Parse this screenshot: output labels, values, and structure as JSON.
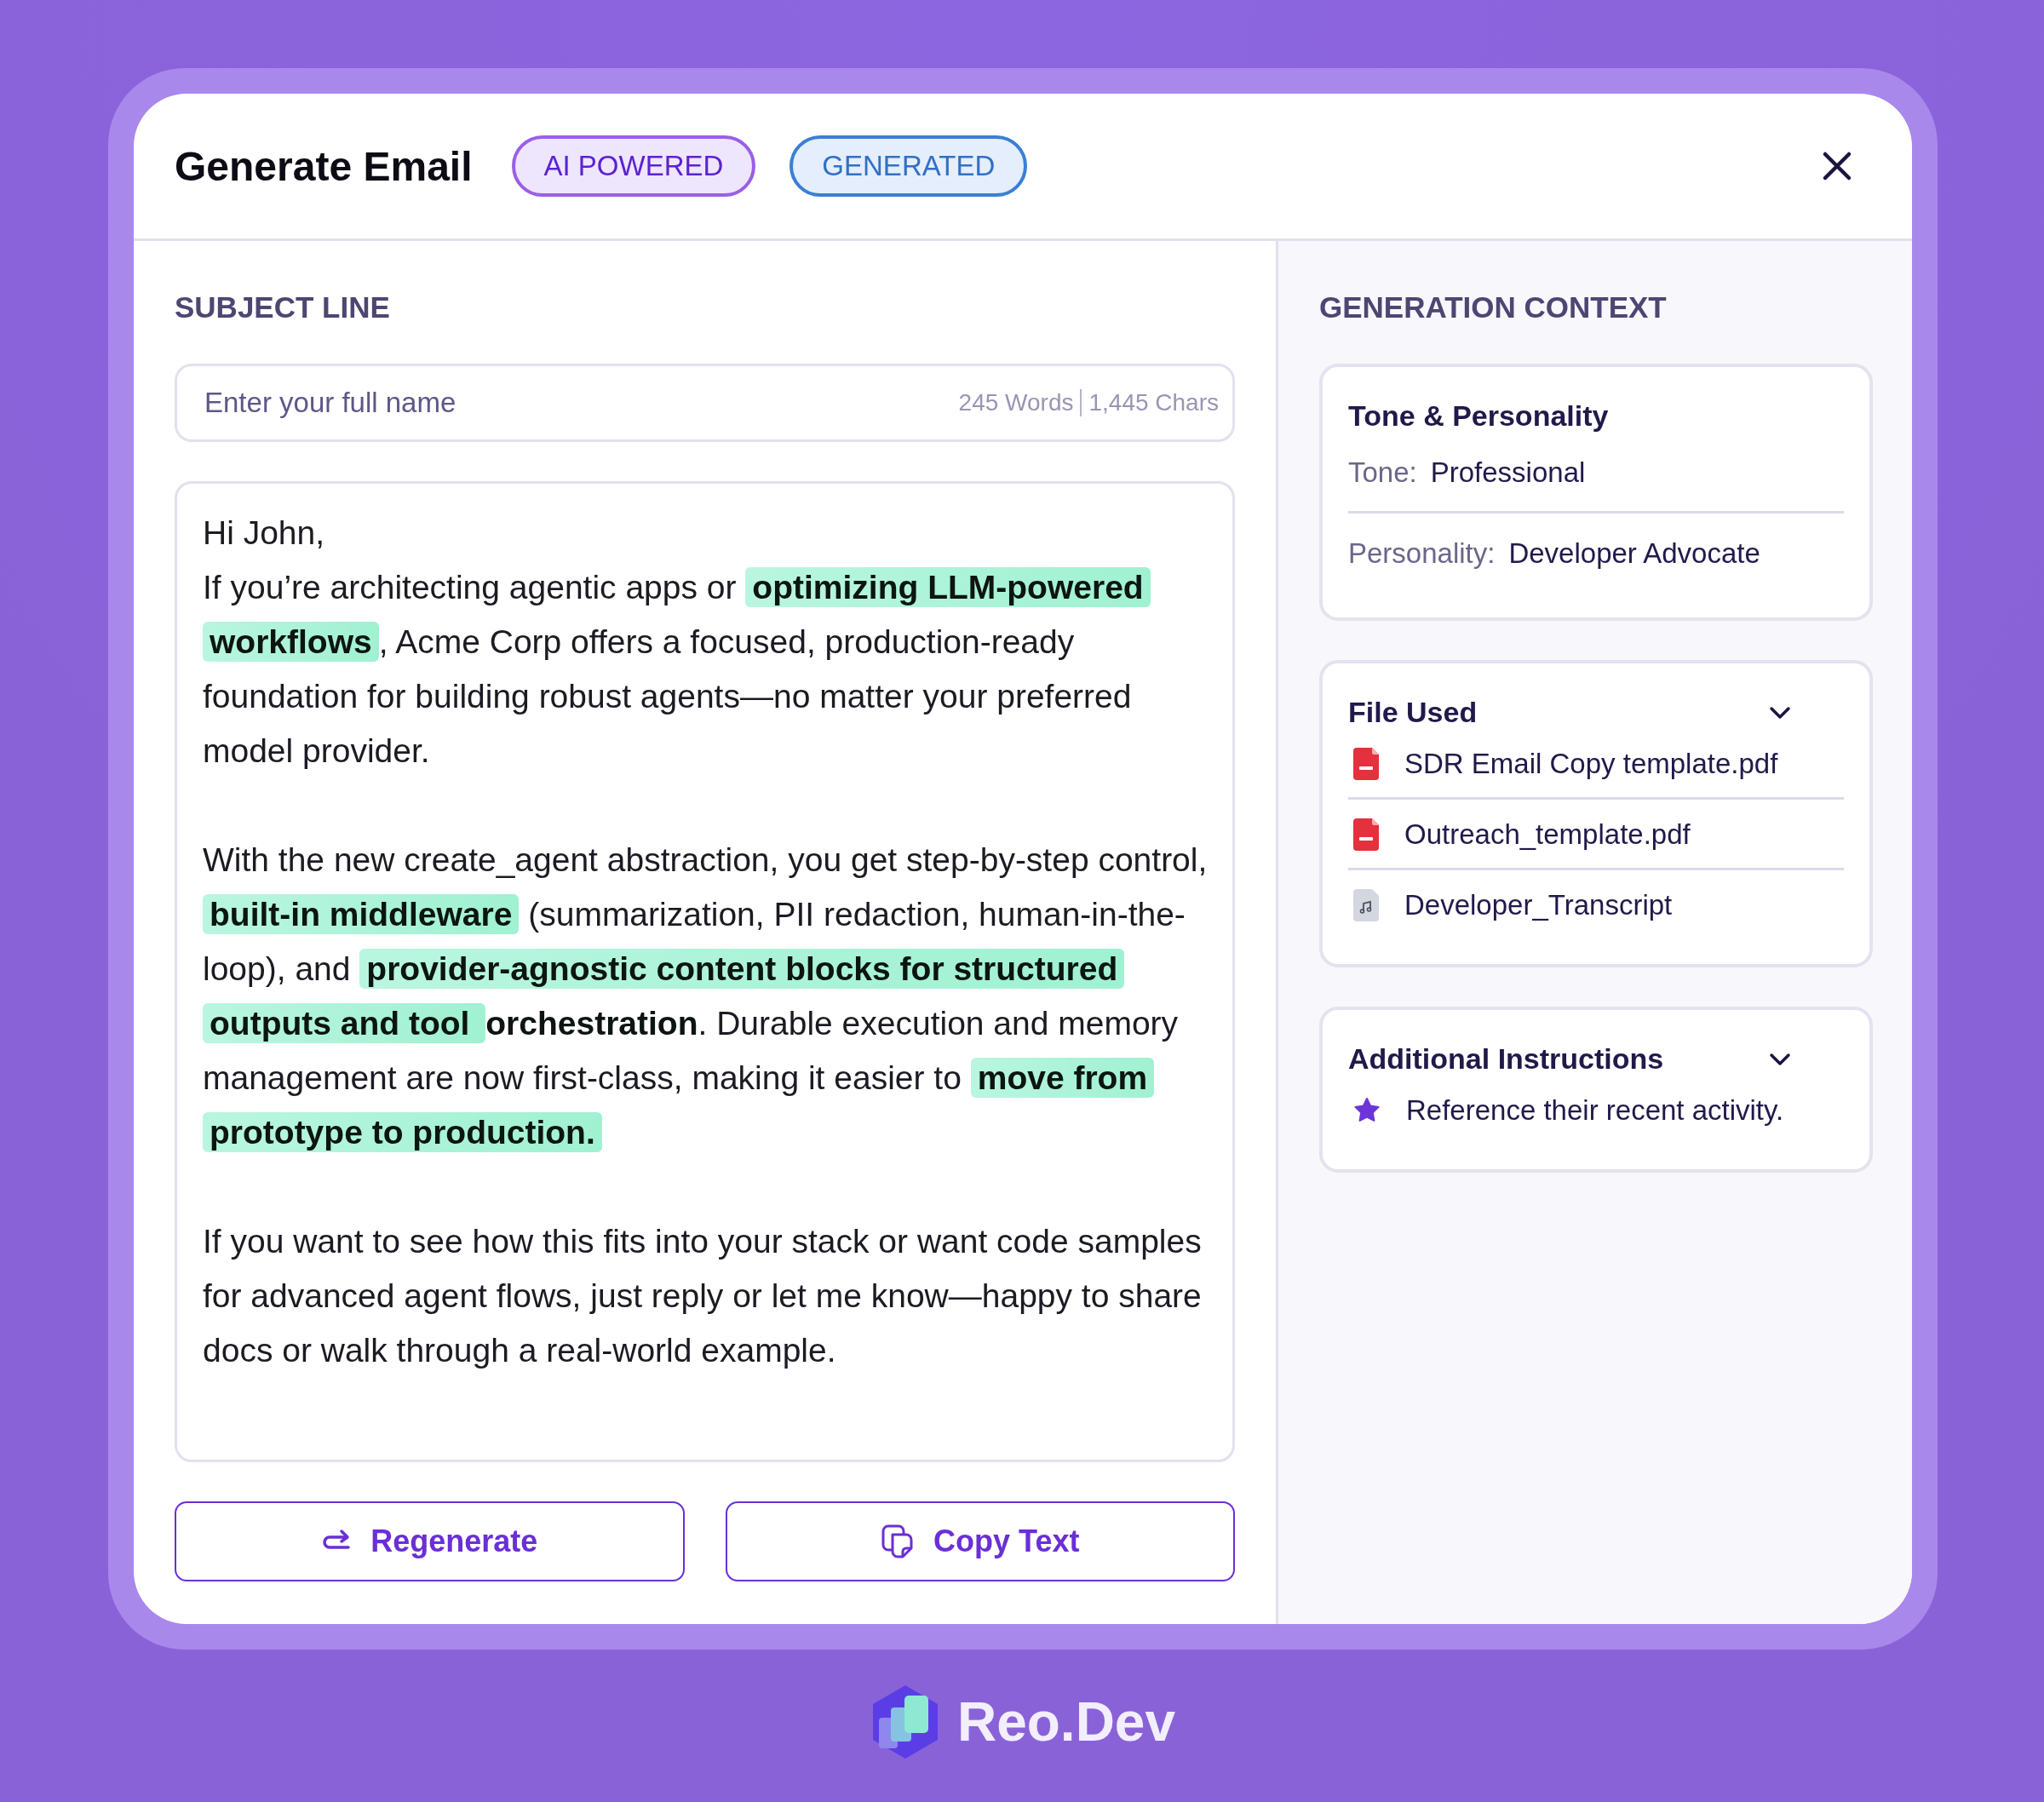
{
  "header": {
    "title": "Generate Email",
    "badges": [
      {
        "label": "AI POWERED",
        "kind": "ai"
      },
      {
        "label": "GENERATED",
        "kind": "status"
      }
    ]
  },
  "subject": {
    "label": "SUBJECT LINE",
    "placeholder": "Enter your full name",
    "words": "245 Words",
    "chars": "1,445 Chars"
  },
  "body": {
    "blocks": [
      {
        "kind": "greeting",
        "segments": [
          {
            "kind": "plain",
            "text": "Hi John,"
          }
        ]
      },
      {
        "kind": "paragraph",
        "segments": [
          {
            "kind": "plain",
            "text": "If you’re architecting agentic apps or "
          },
          {
            "kind": "highlight",
            "text": "optimizing LLM-powered workflows"
          },
          {
            "kind": "plain",
            "text": ", Acme Corp offers a focused, production-ready foundation for building robust agents—no matter your preferred model provider."
          }
        ]
      },
      {
        "kind": "paragraph",
        "segments": [
          {
            "kind": "plain",
            "text": "With the new create_agent abstraction, you get step-by-step control, "
          },
          {
            "kind": "highlight",
            "text": "built-in middleware"
          },
          {
            "kind": "plain",
            "text": " (summarization, PII redaction, human-in-the-loop), and "
          },
          {
            "kind": "highlight",
            "text": "provider-agnostic content blocks for structured outputs and tool "
          },
          {
            "kind": "bold",
            "text": "orchestration"
          },
          {
            "kind": "plain",
            "text": ". Durable execution and memory management are now first-class, making it easier to "
          },
          {
            "kind": "highlight",
            "text": "move from prototype to production."
          }
        ]
      },
      {
        "kind": "paragraph",
        "segments": [
          {
            "kind": "plain",
            "text": "If you want to see how this fits into your stack or want code samples for advanced agent flows, just reply or let me know—happy to share docs or walk through a real-world example."
          }
        ]
      }
    ]
  },
  "actions": [
    {
      "label": "Regenerate",
      "kind": "regenerate"
    },
    {
      "label": "Copy Text",
      "kind": "copy"
    }
  ],
  "context": {
    "title": "GENERATION CONTEXT",
    "tone_card": {
      "title": "Tone & Personality",
      "fields": [
        {
          "label": "Tone:",
          "value": "Professional"
        },
        {
          "label": "Personality:",
          "value": "Developer Advocate"
        }
      ]
    },
    "files_card": {
      "title": "File Used",
      "expanded": true,
      "files": [
        {
          "name": "SDR Email Copy template.pdf",
          "kind": "pdf"
        },
        {
          "name": "Outreach_template.pdf",
          "kind": "pdf"
        },
        {
          "name": "Developer_Transcript",
          "kind": "audio"
        }
      ]
    },
    "instructions_card": {
      "title": "Additional Instructions",
      "expanded": true,
      "items": [
        "Reference their recent activity."
      ]
    }
  },
  "brand": {
    "name": "Reo.Dev"
  }
}
